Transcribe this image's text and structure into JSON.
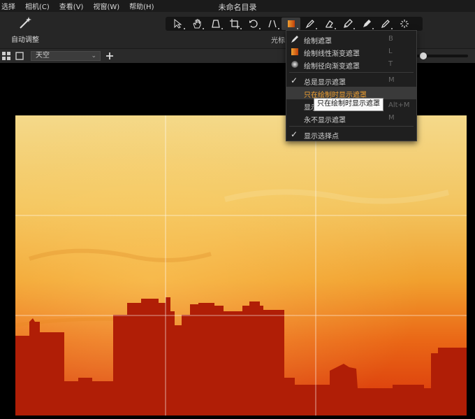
{
  "menu": [
    "选择",
    "相机(C)",
    "查看(V)",
    "视窗(W)",
    "帮助(H)"
  ],
  "window_title": "未命名目录",
  "toolbar": {
    "auto_adjust_label": "自动调整",
    "caption": "光标",
    "tools": [
      "select-cursor-icon",
      "hand-pan-icon",
      "keystone-icon",
      "crop-icon",
      "rotate-icon",
      "straighten-icon",
      "mask-gradient-icon",
      "brush-icon",
      "eraser-icon",
      "pen-icon",
      "fill-icon",
      "pencil-icon",
      "magic-wand-icon"
    ]
  },
  "subbar": {
    "layer_value": "天空",
    "slider_fraction": 0.08
  },
  "dropdown": {
    "items": [
      {
        "label": "绘制遮罩",
        "key": "B",
        "icon": "brush-icon"
      },
      {
        "label": "绘制线性渐变遮罩",
        "key": "L",
        "icon": "linear-gradient-icon"
      },
      {
        "label": "绘制径向渐变遮罩",
        "key": "T",
        "icon": "radial-gradient-icon"
      },
      {
        "label": "总是显示遮罩",
        "key": "M",
        "checked": true
      },
      {
        "label": "只在绘制时显示遮罩",
        "key": "",
        "highlighted": true
      },
      {
        "label": "显示选定的遮罩",
        "key": "Alt+M"
      },
      {
        "label": "永不显示遮罩",
        "key": "M"
      },
      {
        "label": "显示选择点",
        "key": "",
        "checked": true
      }
    ],
    "tooltip": "只在绘制时显示遮罩"
  },
  "colors": {
    "accent": "#f0a030",
    "sky_top": "#f4d98a",
    "sky_bottom": "#e03a08",
    "city": "#b01e06"
  }
}
